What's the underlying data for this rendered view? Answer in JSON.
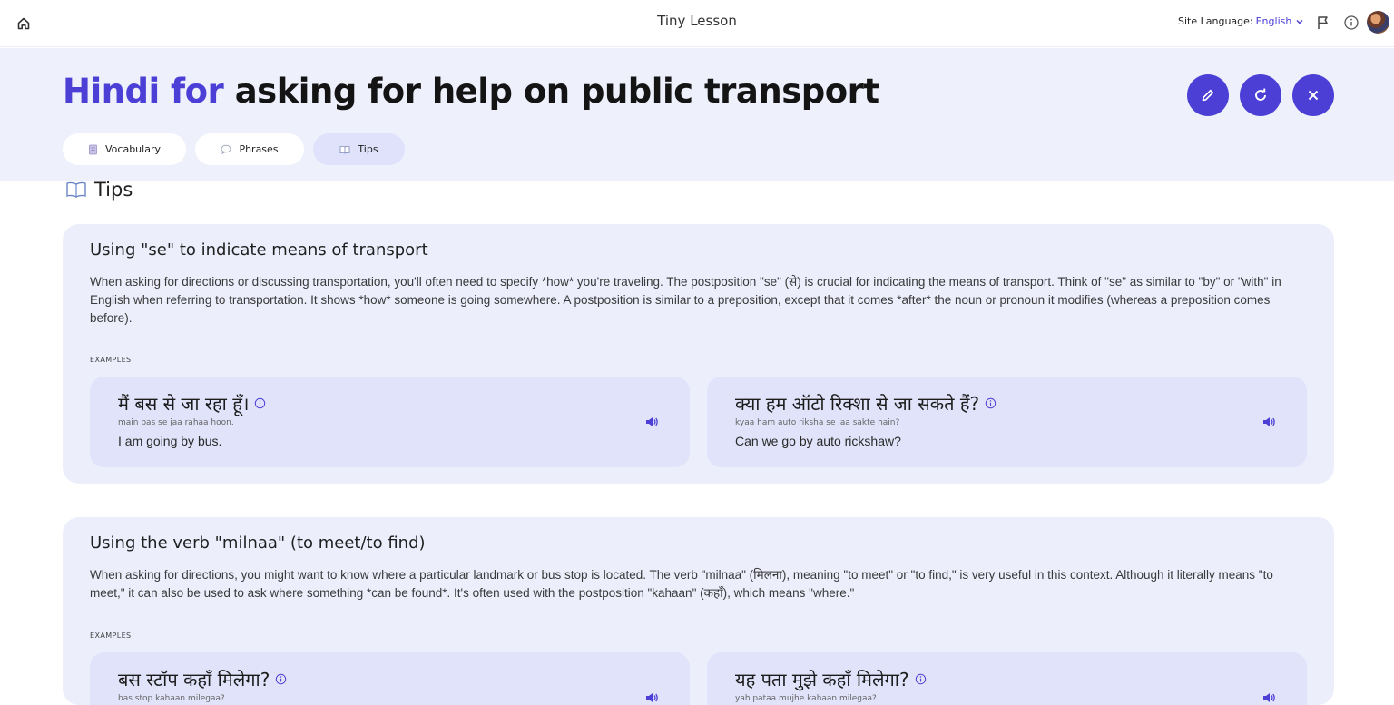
{
  "app": {
    "title": "Tiny Lesson"
  },
  "topbar": {
    "site_language_label": "Site Language:",
    "site_language_value": "English",
    "icons": [
      "home-icon",
      "chevron-down-icon",
      "flag-icon",
      "info-icon",
      "avatar"
    ]
  },
  "page": {
    "title_accent": "Hindi for",
    "title_rest": "asking for help on public transport",
    "actions": [
      "edit-icon",
      "refresh-icon",
      "close-icon"
    ]
  },
  "tabs": [
    {
      "label": "Vocabulary",
      "icon": "notebook-icon",
      "active": false
    },
    {
      "label": "Phrases",
      "icon": "speech-bubble-icon",
      "active": false
    },
    {
      "label": "Tips",
      "icon": "open-book-icon",
      "active": true
    }
  ],
  "section": {
    "icon": "open-book-icon",
    "title": "Tips"
  },
  "tips": [
    {
      "title": "Using \"se\" to indicate means of transport",
      "description": "When asking for directions or discussing transportation, you'll often need to specify *how* you're traveling. The postposition \"se\" (से) is crucial for indicating the means of transport. Think of \"se\" as similar to \"by\" or \"with\" in English when referring to transportation. It shows *how* someone is going somewhere. A postposition is similar to a preposition, except that it comes *after* the noun or pronoun it modifies (whereas a preposition comes before).",
      "examples_label": "EXAMPLES",
      "examples": [
        {
          "native": "मैं बस से जा रहा हूँ।",
          "translit": "main bas se jaa rahaa hoon.",
          "english": "I am going by bus."
        },
        {
          "native": "क्या हम ऑटो रिक्शा से जा सकते हैं?",
          "translit": "kyaa ham auto riksha se jaa sakte hain?",
          "english": "Can we go by auto rickshaw?"
        }
      ]
    },
    {
      "title": "Using the verb \"milnaa\" (to meet/to find)",
      "description": "When asking for directions, you might want to know where a particular landmark or bus stop is located. The verb \"milnaa\" (मिलना), meaning \"to meet\" or \"to find,\" is very useful in this context. Although it literally means \"to meet,\" it can also be used to ask where something *can be found*. It's often used with the postposition \"kahaan\" (कहाँ), which means \"where.\"",
      "examples_label": "EXAMPLES",
      "examples": [
        {
          "native": "बस स्टॉप कहाँ मिलेगा?",
          "translit": "bas stop kahaan milegaa?",
          "english": ""
        },
        {
          "native": "यह पता मुझे कहाँ मिलेगा?",
          "translit": "yah pataa mujhe kahaan milegaa?",
          "english": ""
        }
      ]
    }
  ],
  "colors": {
    "accent": "#4b3fd6",
    "header_bg": "#eef0fc",
    "card_bg": "#eceefc",
    "example_bg": "#e0e3f9"
  }
}
